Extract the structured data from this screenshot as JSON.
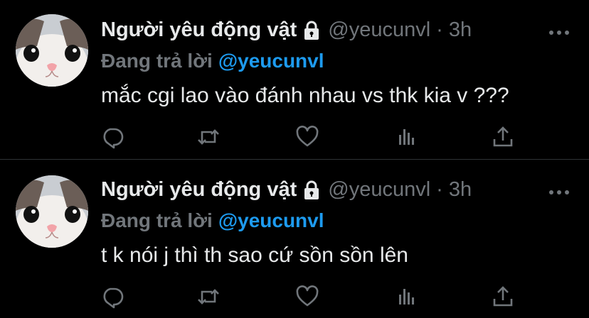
{
  "tweets": [
    {
      "display_name": "Người yêu động vật",
      "handle": "@yeucunvl",
      "separator": "·",
      "time": "3h",
      "reply_prefix": "Đang trả lời",
      "reply_to": "@yeucunvl",
      "text": "mắc cgi lao vào đánh nhau vs thk kia v ???"
    },
    {
      "display_name": "Người yêu động vật",
      "handle": "@yeucunvl",
      "separator": "·",
      "time": "3h",
      "reply_prefix": "Đang trả lời",
      "reply_to": "@yeucunvl",
      "text": "t k nói j thì th sao cứ sồn sồn lên"
    }
  ],
  "icons": {
    "lock": "lock-icon",
    "more": "more-icon",
    "reply": "reply-icon",
    "retweet": "retweet-icon",
    "like": "heart-icon",
    "analytics": "analytics-icon",
    "share": "share-icon"
  },
  "colors": {
    "background": "#000000",
    "text": "#e7e9ea",
    "muted": "#71767b",
    "accent": "#1d9bf0",
    "divider": "#2f3336"
  }
}
